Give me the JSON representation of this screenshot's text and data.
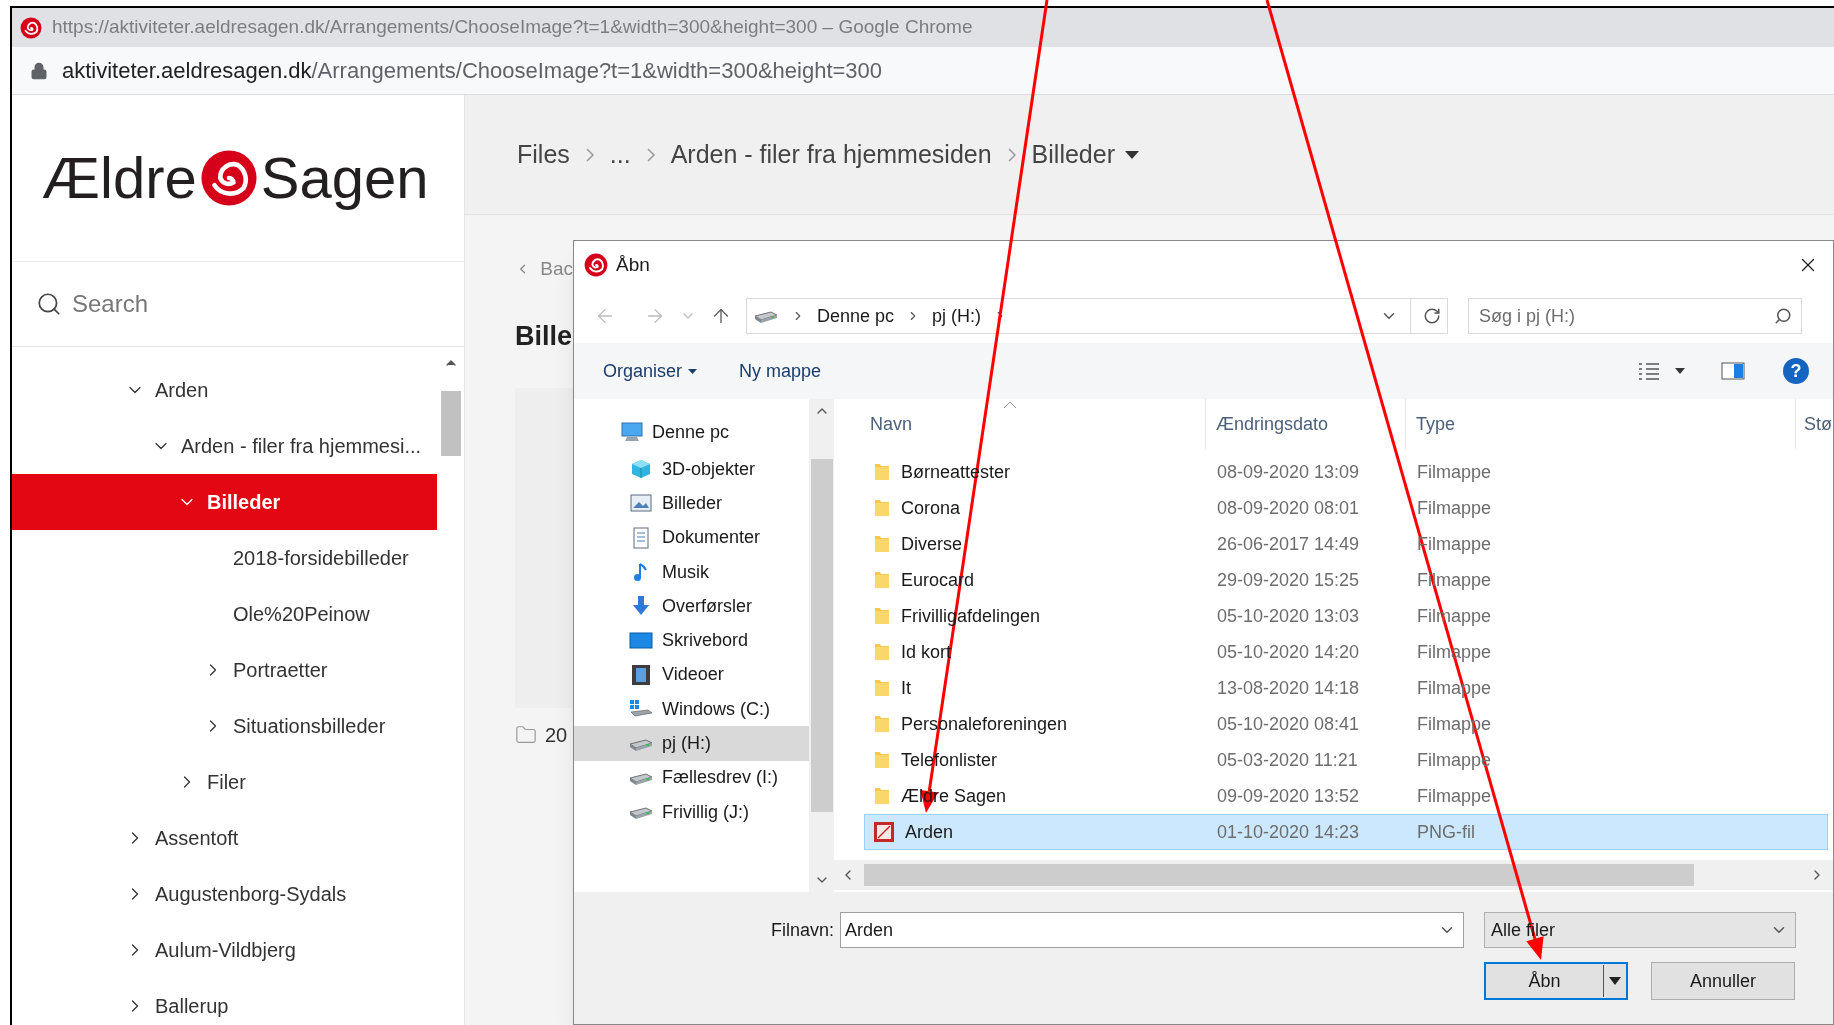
{
  "browser": {
    "title": "https://aktiviteter.aeldresagen.dk/Arrangements/ChooseImage?t=1&width=300&height=300 – Google Chrome",
    "url_host": "aktiviteter.aeldresagen.dk",
    "url_path": "/Arrangements/ChooseImage?t=1&width=300&height=300"
  },
  "sidebar": {
    "logo": {
      "left": "Ældre",
      "right": "Sagen"
    },
    "search": {
      "placeholder": "Search"
    },
    "tree": [
      {
        "label": "Arden",
        "expanded": true,
        "selected": false,
        "children": [
          {
            "label": "Arden - filer fra hjemmesi...",
            "expanded": true,
            "selected": false,
            "children": [
              {
                "label": "Billeder",
                "expanded": true,
                "selected": true,
                "children": [
                  {
                    "label": "2018-forsidebilleder",
                    "selected": false
                  },
                  {
                    "label": "Ole%20Peinow",
                    "selected": false
                  },
                  {
                    "label": "Portraetter",
                    "expanded": false,
                    "selected": false
                  },
                  {
                    "label": "Situationsbilleder",
                    "expanded": false,
                    "selected": false
                  }
                ]
              },
              {
                "label": "Filer",
                "expanded": false,
                "selected": false
              }
            ]
          }
        ]
      },
      {
        "label": "Assentoft",
        "expanded": false,
        "selected": false
      },
      {
        "label": "Augustenborg-Sydals",
        "expanded": false,
        "selected": false
      },
      {
        "label": "Aulum-Vildbjerg",
        "expanded": false,
        "selected": false
      },
      {
        "label": "Ballerup",
        "expanded": false,
        "selected": false
      }
    ]
  },
  "main": {
    "breadcrumb": [
      {
        "label": "Files",
        "dropdown": false
      },
      {
        "label": "...",
        "dropdown": false
      },
      {
        "label": "Arden - filer fra hjemmesiden",
        "dropdown": false
      },
      {
        "label": "Billeder",
        "dropdown": true
      }
    ],
    "back": "Bac",
    "heading": "Bille",
    "folder_label": "20"
  },
  "dialog": {
    "title": "Åbn",
    "address": [
      "Denne pc",
      "pj (H:)"
    ],
    "search": {
      "placeholder": "Søg i pj (H:)"
    },
    "toolbar": {
      "organise": "Organiser",
      "new_folder": "Ny mappe",
      "help": "?"
    },
    "nav_pane": [
      {
        "label": "Denne pc",
        "selected": false,
        "children": [
          {
            "label": "3D-objekter",
            "selected": false
          },
          {
            "label": "Billeder",
            "selected": false
          },
          {
            "label": "Dokumenter",
            "selected": false
          },
          {
            "label": "Musik",
            "selected": false
          },
          {
            "label": "Overførsler",
            "selected": false
          },
          {
            "label": "Skrivebord",
            "selected": false
          },
          {
            "label": "Videoer",
            "selected": false
          },
          {
            "label": "Windows (C:)",
            "selected": false
          },
          {
            "label": "pj (H:)",
            "selected": true
          },
          {
            "label": "Fællesdrev (I:)",
            "selected": false
          },
          {
            "label": "Frivillig (J:)",
            "selected": false
          }
        ]
      }
    ],
    "columns": [
      "Navn",
      "Ændringsdato",
      "Type",
      "Stø"
    ],
    "files": [
      {
        "name": "Børneattester",
        "date": "08-09-2020 13:09",
        "type": "Filmappe",
        "kind": "folder",
        "selected": false
      },
      {
        "name": "Corona",
        "date": "08-09-2020 08:01",
        "type": "Filmappe",
        "kind": "folder",
        "selected": false
      },
      {
        "name": "Diverse",
        "date": "26-06-2017 14:49",
        "type": "Filmappe",
        "kind": "folder",
        "selected": false
      },
      {
        "name": "Eurocard",
        "date": "29-09-2020 15:25",
        "type": "Filmappe",
        "kind": "folder",
        "selected": false
      },
      {
        "name": "Frivilligafdelingen",
        "date": "05-10-2020 13:03",
        "type": "Filmappe",
        "kind": "folder",
        "selected": false
      },
      {
        "name": "Id kort",
        "date": "05-10-2020 14:20",
        "type": "Filmappe",
        "kind": "folder",
        "selected": false
      },
      {
        "name": "It",
        "date": "13-08-2020 14:18",
        "type": "Filmappe",
        "kind": "folder",
        "selected": false
      },
      {
        "name": "Personaleforeningen",
        "date": "05-10-2020 08:41",
        "type": "Filmappe",
        "kind": "folder",
        "selected": false
      },
      {
        "name": "Telefonlister",
        "date": "05-03-2020 11:21",
        "type": "Filmappe",
        "kind": "folder",
        "selected": false
      },
      {
        "name": "Ældre Sagen",
        "date": "09-09-2020 13:52",
        "type": "Filmappe",
        "kind": "folder",
        "selected": false
      },
      {
        "name": "Arden",
        "date": "01-10-2020 14:23",
        "type": "PNG-fil",
        "kind": "image",
        "selected": true
      }
    ],
    "filename": {
      "label": "Filnavn:",
      "value": "Arden"
    },
    "filter": "Alle filer",
    "buttons": {
      "open": "Åbn",
      "cancel": "Annuller"
    }
  }
}
